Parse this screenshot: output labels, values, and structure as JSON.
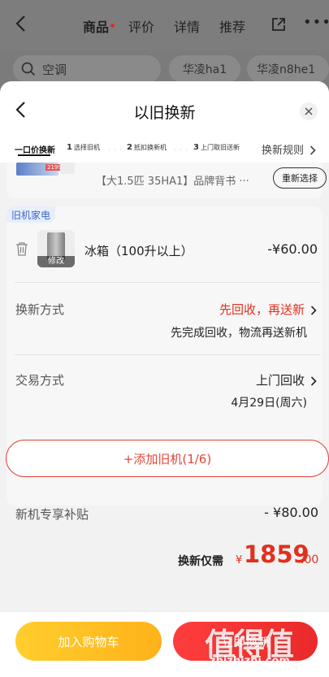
{
  "background_page": {
    "tabs": [
      "商品",
      "评价",
      "详情",
      "推荐"
    ],
    "search_placeholder": "空调",
    "chips": [
      "华凌ha1",
      "华凌n8he1"
    ]
  },
  "sheet": {
    "title": "以旧换新",
    "steps": {
      "main": "一口价换新",
      "step1_num": "1",
      "step1": "选择旧机",
      "step2_num": "2",
      "step2": "抵扣换新机",
      "step3_num": "3",
      "step3": "上门取旧送新",
      "dots": "· · ·",
      "rules": "换新规则"
    },
    "product": {
      "thumb_tag": "2199",
      "name": "【大1.5匹 35HA1】品牌背书 ···",
      "reselect_label": "重新选择"
    },
    "old_item": {
      "tag": "旧机家电",
      "image_edit_label": "修改",
      "name": "冰箱（100升以上）",
      "price": "-¥60.00"
    },
    "exchange_method": {
      "label": "换新方式",
      "value": "先回收，再送新",
      "sub": "先完成回收，物流再送新机"
    },
    "trade_method": {
      "label": "交易方式",
      "value": "上门回收",
      "sub": "4月29日(周六)"
    },
    "add_old_label": "+添加旧机(1/6)",
    "subsidy": {
      "label": "新机专享补贴",
      "value": "- ¥80.00"
    },
    "need": {
      "label": "换新仅需",
      "yuan": "¥",
      "int": "1859",
      "dec": ".00"
    }
  },
  "bottom": {
    "cart_label": "加入购物车",
    "buy_label": "立即换新"
  },
  "watermark": {
    "chars": "值得值",
    "url": "zhizhizhi.com"
  }
}
